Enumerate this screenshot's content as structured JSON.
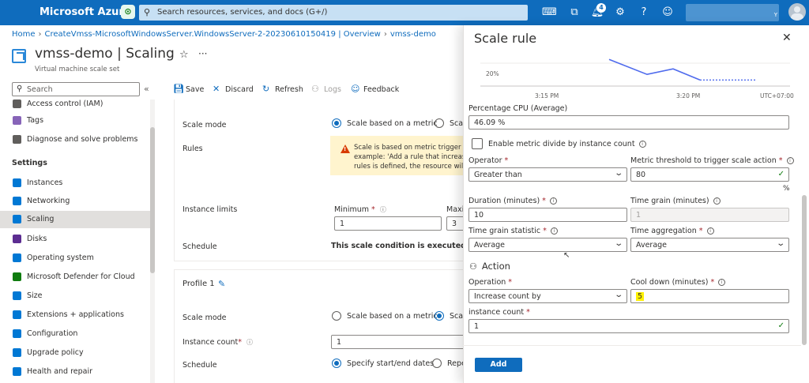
{
  "topbar": {
    "brand": "Microsoft Azure",
    "search_placeholder": "Search resources, services, and docs (G+/)",
    "notifications_count": "4",
    "user_initial": "Y"
  },
  "breadcrumb": [
    "Home",
    "CreateVmss-MicrosoftWindowsServer.WindowsServer-2-20230610150419 | Overview",
    "vmss-demo"
  ],
  "header": {
    "title": "vmss-demo | Scaling",
    "subtitle": "Virtual machine scale set"
  },
  "sidebar": {
    "search_placeholder": "Search",
    "items_top": [
      {
        "label": "Access control (IAM)",
        "color": "#605e5c"
      },
      {
        "label": "Tags",
        "color": "#8764b8"
      },
      {
        "label": "Diagnose and solve problems",
        "color": "#605e5c"
      }
    ],
    "section": "Settings",
    "items": [
      {
        "label": "Instances",
        "color": "#0078d4"
      },
      {
        "label": "Networking",
        "color": "#0078d4"
      },
      {
        "label": "Scaling",
        "color": "#0078d4",
        "selected": true
      },
      {
        "label": "Disks",
        "color": "#5c2d91"
      },
      {
        "label": "Operating system",
        "color": "#0078d4"
      },
      {
        "label": "Microsoft Defender for Cloud",
        "color": "#107c10"
      },
      {
        "label": "Size",
        "color": "#0078d4"
      },
      {
        "label": "Extensions + applications",
        "color": "#0078d4"
      },
      {
        "label": "Configuration",
        "color": "#0078d4"
      },
      {
        "label": "Upgrade policy",
        "color": "#0078d4"
      },
      {
        "label": "Health and repair",
        "color": "#0078d4"
      }
    ]
  },
  "toolbar": {
    "save": "Save",
    "discard": "Discard",
    "refresh": "Refresh",
    "logs": "Logs",
    "feedback": "Feedback"
  },
  "main": {
    "condition1": {
      "scale_mode_label": "Scale mode",
      "opt_metric": "Scale based on a metric",
      "opt_specific": "Scal",
      "rules_label": "Rules",
      "warning_lines": [
        "Scale is based on metric trigger rul",
        "example: 'Add a rule that increases",
        "rules is defined, the resource will b"
      ],
      "instance_limits_label": "Instance limits",
      "minimum_label": "Minimum",
      "maximum_label": "Maxi",
      "minimum_value": "1",
      "maximum_value": "3",
      "schedule_label": "Schedule",
      "schedule_text": "This scale condition is executed whe"
    },
    "profile": {
      "title": "Profile 1",
      "scale_mode_label": "Scale mode",
      "opt_metric": "Scale based on a metric",
      "opt_specific": "Scal",
      "instance_count_label": "Instance count",
      "instance_count_value": "1",
      "schedule_label": "Schedule",
      "opt_dates": "Specify start/end dates",
      "opt_repeat": "Repe"
    }
  },
  "panel": {
    "title": "Scale rule",
    "chart_data": {
      "type": "line",
      "x_ticks": [
        "3:15 PM",
        "3:20 PM",
        "UTC+07:00"
      ],
      "y_ticks": [
        "20%"
      ],
      "series": [
        {
          "values": [
            48,
            21,
            31,
            11
          ],
          "solid": true
        },
        {
          "values": [
            11,
            11
          ],
          "dashed": true
        }
      ]
    },
    "metric_label": "Percentage CPU (Average)",
    "metric_value": "46.09 %",
    "divide_label": "Enable metric divide by instance count",
    "operator_label": "Operator",
    "operator_value": "Greater than",
    "threshold_label": "Metric threshold to trigger scale action",
    "threshold_value": "80",
    "threshold_unit": "%",
    "duration_label": "Duration (minutes)",
    "duration_value": "10",
    "grain_label": "Time grain (minutes)",
    "grain_value": "1",
    "grain_stat_label": "Time grain statistic",
    "grain_stat_value": "Average",
    "aggregation_label": "Time aggregation",
    "aggregation_value": "Average",
    "action_head": "Action",
    "operation_label": "Operation",
    "operation_value": "Increase count by",
    "cooldown_label": "Cool down (minutes)",
    "cooldown_value": "5",
    "instance_count_label": "instance count",
    "instance_count_value": "1",
    "add_button": "Add"
  }
}
